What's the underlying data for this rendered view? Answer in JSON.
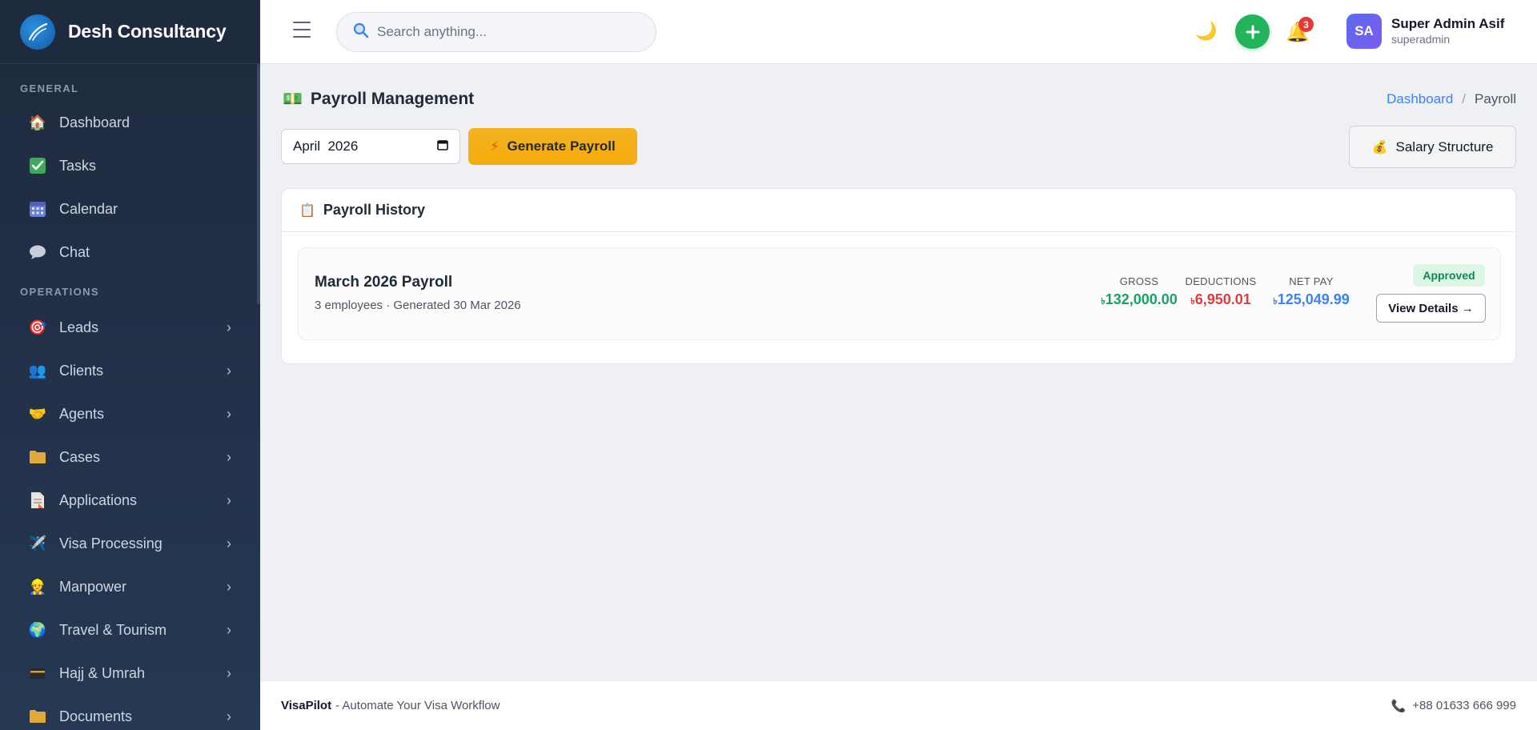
{
  "brand": {
    "name": "Desh Consultancy"
  },
  "sidebar": {
    "sections": [
      {
        "title": "GENERAL",
        "items": [
          {
            "label": "Dashboard",
            "icon": "house-icon",
            "has_children": false
          },
          {
            "label": "Tasks",
            "icon": "check-box-icon",
            "has_children": false
          },
          {
            "label": "Calendar",
            "icon": "calendar-icon",
            "has_children": false
          },
          {
            "label": "Chat",
            "icon": "chat-bubble-icon",
            "has_children": false
          }
        ]
      },
      {
        "title": "OPERATIONS",
        "items": [
          {
            "label": "Leads",
            "icon": "target-icon",
            "has_children": true
          },
          {
            "label": "Clients",
            "icon": "users-icon",
            "has_children": true
          },
          {
            "label": "Agents",
            "icon": "handshake-icon",
            "has_children": true
          },
          {
            "label": "Cases",
            "icon": "folder-icon",
            "has_children": true
          },
          {
            "label": "Applications",
            "icon": "document-icon",
            "has_children": true
          },
          {
            "label": "Visa Processing",
            "icon": "airplane-icon",
            "has_children": true
          },
          {
            "label": "Manpower",
            "icon": "worker-icon",
            "has_children": true
          },
          {
            "label": "Travel & Tourism",
            "icon": "globe-icon",
            "has_children": true
          },
          {
            "label": "Hajj & Umrah",
            "icon": "kaaba-icon",
            "has_children": true
          },
          {
            "label": "Documents",
            "icon": "folder-icon",
            "has_children": true
          }
        ]
      }
    ]
  },
  "header": {
    "search_placeholder": "Search anything...",
    "notification_count": "3",
    "user": {
      "initials": "SA",
      "name": "Super Admin Asif",
      "role": "superadmin"
    }
  },
  "page": {
    "title": "Payroll Management",
    "breadcrumb": {
      "parent": "Dashboard",
      "separator": "/",
      "current": "Payroll"
    },
    "month_value": "April  2026",
    "generate_label": "Generate Payroll",
    "salary_structure_label": "Salary Structure"
  },
  "history": {
    "title": "Payroll History",
    "items": [
      {
        "title": "March 2026 Payroll",
        "subtitle": "3 employees · Generated 30 Mar 2026",
        "gross_label": "GROSS",
        "gross_value": "132,000.00",
        "deductions_label": "DEDUCTIONS",
        "deductions_value": "6,950.01",
        "net_label": "NET PAY",
        "net_value": "125,049.99",
        "currency_symbol": "৳",
        "status": "Approved",
        "action_label": "View Details →"
      }
    ]
  },
  "footer": {
    "brand": "VisaPilot",
    "tagline": "- Automate Your Visa Workflow",
    "phone": "+88 01633 666 999"
  },
  "colors": {
    "sidebar_bg": "#1e2a3d",
    "accent_blue": "#3b82f6",
    "gross_green": "#16a364",
    "deduction_red": "#e23b3b",
    "generate_yellow": "#f5b21d",
    "add_green": "#22b45a"
  }
}
